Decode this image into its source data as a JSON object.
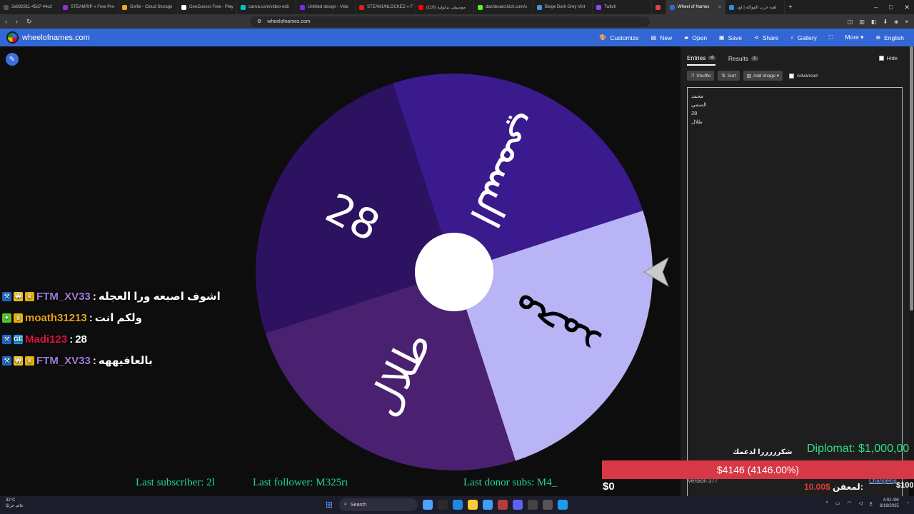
{
  "browser": {
    "tabs": [
      {
        "title": "2e692911-45d7-44cd",
        "color": "#555555"
      },
      {
        "title": "STEAMRIP » Free Pre-",
        "color": "#9a2cd6"
      },
      {
        "title": "Gofile - Cloud Storage",
        "color": "#f5a623"
      },
      {
        "title": "GeoGuessr Free - Play",
        "color": "#ffffff"
      },
      {
        "title": "canva.com/video-edit",
        "color": "#00c4cc"
      },
      {
        "title": "Untitled design - Vide",
        "color": "#7d2ae8"
      },
      {
        "title": "STEAMUNLOCKED » F",
        "color": "#e01e1e"
      },
      {
        "title": "(116) موسيقى بيانولية",
        "color": "#ff0000"
      },
      {
        "title": "dashboard.kick.com/s",
        "color": "#53fc18"
      },
      {
        "title": "Beige Dark Grey Vint",
        "color": "#4a90e2"
      },
      {
        "title": "Twitch",
        "color": "#9146ff"
      },
      {
        "title": "",
        "color": "#e04040"
      },
      {
        "title": "Wheel of Names",
        "color": "#3367d6",
        "active": true,
        "close": "×"
      },
      {
        "title": "لعبة حرب الفواكه | لود",
        "color": "#2b8fe0"
      }
    ],
    "new_tab": "+",
    "window_controls": [
      "–",
      "□",
      "✕"
    ],
    "nav": [
      "‹",
      "›",
      "↻"
    ],
    "url": "wheelofnames.com",
    "bookmark_icon": "☐"
  },
  "app": {
    "site_name": "wheelofnames.com",
    "toolbar": [
      {
        "label": "Customize",
        "icon": "🎨",
        "name": "customize"
      },
      {
        "label": "New",
        "icon": "▤",
        "name": "new"
      },
      {
        "label": "Open",
        "icon": "▰",
        "name": "open"
      },
      {
        "label": "Save",
        "icon": "▣",
        "name": "save"
      },
      {
        "label": "Share",
        "icon": "⋖",
        "name": "share"
      },
      {
        "label": "Gallery",
        "icon": "⌕",
        "name": "gallery"
      },
      {
        "label": "",
        "icon": "⛶",
        "name": "fullscreen"
      },
      {
        "label": "More ▾",
        "icon": "",
        "name": "more"
      },
      {
        "label": "English",
        "icon": "⊕",
        "name": "language"
      }
    ],
    "edit_icon": "✎"
  },
  "wheel": {
    "segments": [
      {
        "label": "السمي",
        "color": "#3a1a8c",
        "text_color": "#ffffff"
      },
      {
        "label": "محمد",
        "color": "#b8b4f5",
        "text_color": "#000000"
      },
      {
        "label": "طلال",
        "color": "#4a2070",
        "text_color": "#ffffff"
      },
      {
        "label": "28",
        "color": "#2c1260",
        "text_color": "#ffffff"
      }
    ],
    "center_color": "#ffffff",
    "pointer_color": "#c9c9c9"
  },
  "chat": [
    {
      "user": "FTM_XV33",
      "user_color": "#9d7bd8",
      "badges": [
        "⚒",
        "₩",
        "♛"
      ],
      "message": "اشوف اصبعه ورا العجله"
    },
    {
      "user": "moath31213",
      "user_color": "#e8a21a",
      "badges": [
        "✦",
        "♛"
      ],
      "message": "ولكم انت"
    },
    {
      "user": "Madi123",
      "user_color": "#d8163c",
      "badges": [
        "⚒",
        "GE"
      ],
      "message": "28"
    },
    {
      "user": "FTM_XV33",
      "user_color": "#9d7bd8",
      "badges": [
        "⚒",
        "₩",
        "♛"
      ],
      "message": "بالعافيههه"
    }
  ],
  "panel": {
    "tabs": [
      {
        "label": "Entries",
        "count": "4",
        "active": true
      },
      {
        "label": "Results",
        "count": "1",
        "active": false
      }
    ],
    "hide_label": "Hide",
    "actions": [
      {
        "label": "Shuffle",
        "icon": "⤨"
      },
      {
        "label": "Sort",
        "icon": "⇅"
      },
      {
        "label": "Add image ▾",
        "icon": "▨"
      }
    ],
    "advanced_label": "Advanced",
    "entries": [
      "محمد",
      "السمي",
      "28",
      "طلال"
    ],
    "version": "Version 377",
    "changelog": "Changelog"
  },
  "overlay": {
    "last_subscriber": "Last subscriber: 2l",
    "last_follower": "Last follower: M325rı",
    "last_donor": "Last donor subs: M4_",
    "goal": "Diplomat: $1,000,00",
    "thanks": "شكرررررا لدعمك",
    "progress": "$4146 (4146.00%)",
    "zero": "$0",
    "hundred": "$100",
    "top_donor_name": "لمعفن:",
    "top_donor_amount": "10.00$"
  },
  "taskbar": {
    "temp": "32°C",
    "weather": "غائم جزئيًا",
    "search": "Search",
    "tray_lang": "ع",
    "time": "4:02 AM",
    "date": "8/19/2025",
    "apps": [
      "#4ba3ff",
      "#2b2b2b",
      "#1e88e5",
      "#ffcc33",
      "#3aa0ff",
      "#b53c3c",
      "#5b64f2",
      "#444444",
      "#555555",
      "#1d9bf0"
    ]
  }
}
